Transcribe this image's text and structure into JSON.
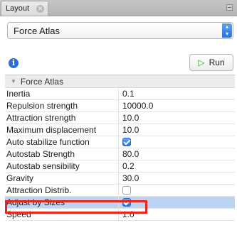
{
  "window": {
    "tab_title": "Layout",
    "close_glyph": "✕"
  },
  "dropdown": {
    "selected": "Force Atlas",
    "arrow_glyph": "▴\n▾"
  },
  "info_glyph": "i",
  "run_button": {
    "label": "Run",
    "icon": "▷"
  },
  "section": {
    "title": "Force Atlas",
    "toggle_glyph": "▼"
  },
  "properties": [
    {
      "name": "Inertia",
      "value": "0.1"
    },
    {
      "name": "Repulsion strength",
      "value": "10000.0"
    },
    {
      "name": "Attraction strength",
      "value": "10.0"
    },
    {
      "name": "Maximum displacement",
      "value": "10.0"
    },
    {
      "name": "Auto stabilize function",
      "checked": true
    },
    {
      "name": "Autostab Strength",
      "value": "80.0"
    },
    {
      "name": "Autostab sensibility",
      "value": "0.2"
    },
    {
      "name": "Gravity",
      "value": "30.0"
    },
    {
      "name": "Attraction Distrib.",
      "checked": false
    },
    {
      "name": "Adjust by Sizes",
      "checked": true,
      "selected": true
    },
    {
      "name": "Speed",
      "value": "1.0"
    }
  ],
  "colors": {
    "highlight_box": "#e8261c",
    "selected_row": "#bcd4f2",
    "checkbox_on": "#2b75e2"
  }
}
